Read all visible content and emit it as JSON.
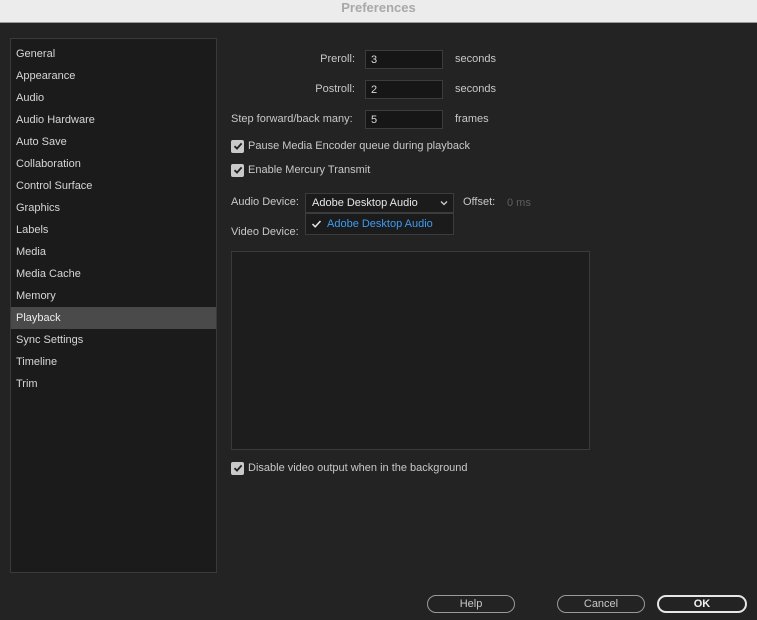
{
  "window": {
    "title": "Preferences"
  },
  "sidebar": {
    "items": [
      {
        "label": "General"
      },
      {
        "label": "Appearance"
      },
      {
        "label": "Audio"
      },
      {
        "label": "Audio Hardware"
      },
      {
        "label": "Auto Save"
      },
      {
        "label": "Collaboration"
      },
      {
        "label": "Control Surface"
      },
      {
        "label": "Graphics"
      },
      {
        "label": "Labels"
      },
      {
        "label": "Media"
      },
      {
        "label": "Media Cache"
      },
      {
        "label": "Memory"
      },
      {
        "label": "Playback",
        "selected": true
      },
      {
        "label": "Sync Settings"
      },
      {
        "label": "Timeline"
      },
      {
        "label": "Trim"
      }
    ]
  },
  "playback": {
    "preroll": {
      "label": "Preroll:",
      "value": "3",
      "unit": "seconds"
    },
    "postroll": {
      "label": "Postroll:",
      "value": "2",
      "unit": "seconds"
    },
    "step": {
      "label": "Step forward/back many:",
      "value": "5",
      "unit": "frames"
    },
    "pause_encoder": {
      "label": "Pause Media Encoder queue during playback",
      "checked": true
    },
    "mercury": {
      "label": "Enable Mercury Transmit",
      "checked": true
    },
    "audio_device": {
      "label": "Audio Device:",
      "selected": "Adobe Desktop Audio",
      "options": [
        "Adobe Desktop Audio"
      ],
      "offset_label": "Offset:",
      "offset_value": "0 ms"
    },
    "video_device": {
      "label": "Video Device:"
    },
    "disable_video": {
      "label": "Disable video output when in the background",
      "checked": true
    }
  },
  "buttons": {
    "help": "Help",
    "cancel": "Cancel",
    "ok": "OK"
  },
  "colors": {
    "accent": "#3d9cf0",
    "selected_row": "#4a4a4a"
  }
}
